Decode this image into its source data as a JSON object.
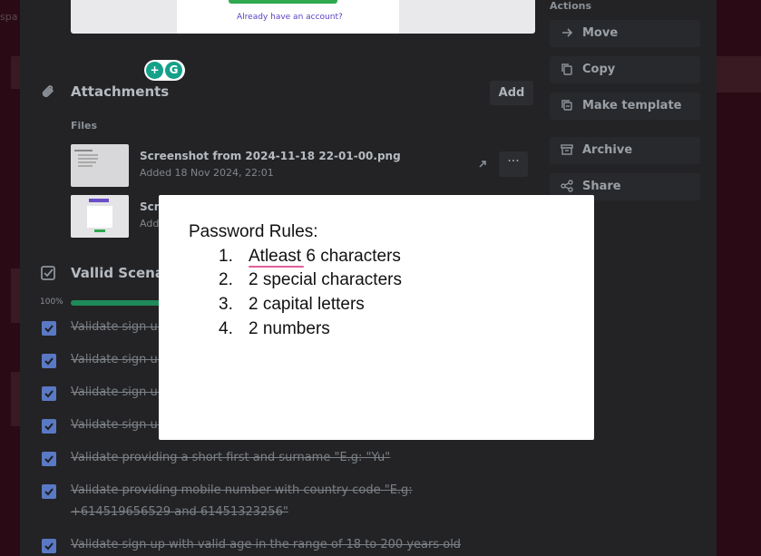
{
  "background": {
    "edge_text": "spa"
  },
  "preview": {
    "link_text": "Already have an account?"
  },
  "grammarly": {
    "icon_a": "grammarly-add-icon",
    "icon_b": "grammarly-g-icon"
  },
  "attachments": {
    "title": "Attachments",
    "add_label": "Add",
    "files_label": "Files",
    "files": [
      {
        "name": "Screenshot from 2024-11-18 22-01-00.png",
        "date": "Added 18 Nov 2024, 22:01"
      },
      {
        "name": "Scr",
        "date": "Add"
      }
    ],
    "menu_label": "···"
  },
  "checklist": {
    "title": "Vallid Scenar",
    "progress_label": "100%",
    "progress_value": 1.0,
    "items": [
      "Validate sign up",
      "Validate sign up",
      "Validate sign up",
      "Validate sign up",
      "Validate providing a short first and surname \"E.g: \"Yu\"",
      "Validate providing mobile number with country code \"E.g:",
      "+614519656529 and 61451323256\"",
      "Validate sign up with valid age in the range of 18 to 200 years old"
    ]
  },
  "actions": {
    "label": "Actions",
    "move": "Move",
    "copy": "Copy",
    "make_template": "Make template",
    "archive": "Archive",
    "share": "Share"
  },
  "modal": {
    "title": "Password Rules:",
    "rules": [
      {
        "num": "1.",
        "text": "Atleast 6 characters"
      },
      {
        "num": "2.",
        "text": "2 special characters"
      },
      {
        "num": "3.",
        "text": "2 capital letters"
      },
      {
        "num": "4.",
        "text": "2 numbers"
      }
    ]
  },
  "colors": {
    "accent_green": "#1f8a5a",
    "checkbox_blue": "#5a79c4",
    "spell_underline": "#e0609a"
  }
}
